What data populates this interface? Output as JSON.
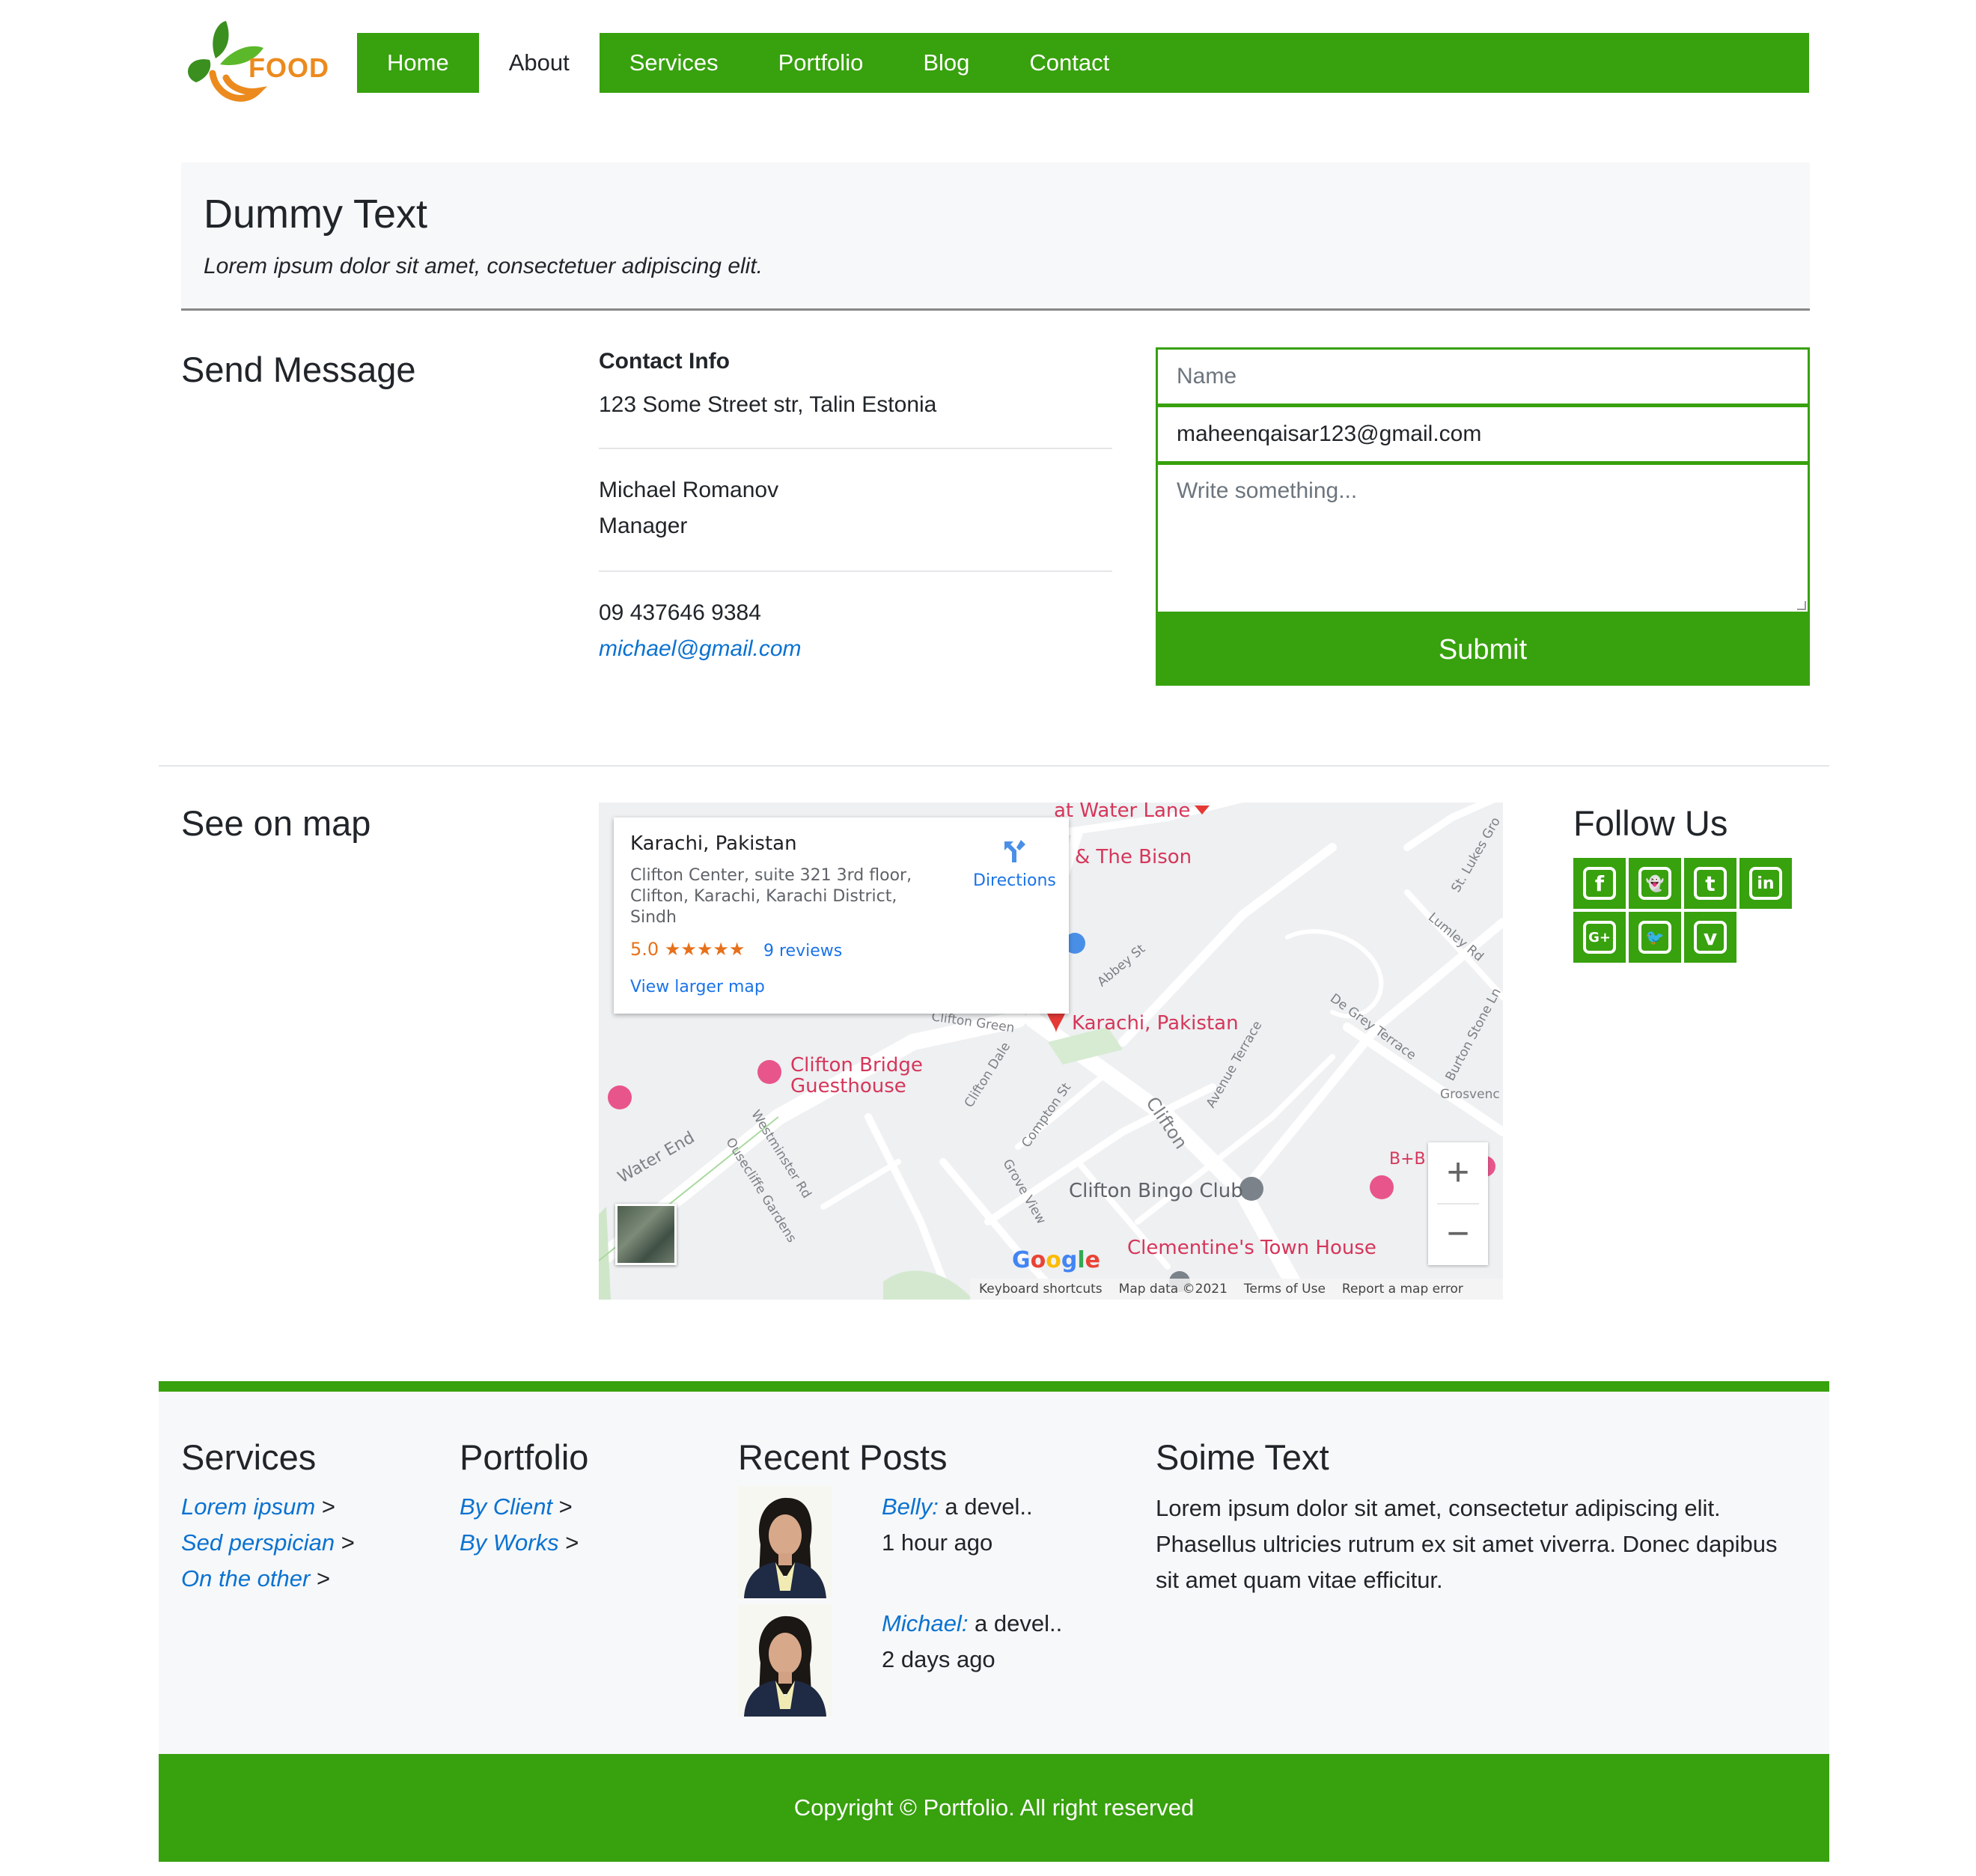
{
  "brand": {
    "logo_text": "FOOD"
  },
  "nav": {
    "items": [
      {
        "label": "Home",
        "active": false
      },
      {
        "label": "About",
        "active": true
      },
      {
        "label": "Services",
        "active": false
      },
      {
        "label": "Portfolio",
        "active": false
      },
      {
        "label": "Blog",
        "active": false
      },
      {
        "label": "Contact",
        "active": false
      }
    ]
  },
  "jumbotron": {
    "title": "Dummy Text",
    "subtitle": "Lorem ipsum dolor sit amet, consectetuer adipiscing elit."
  },
  "send_message": {
    "title": "Send Message",
    "contact_info": {
      "heading": "Contact Info",
      "address": "123 Some Street str, Talin Estonia",
      "person_name": "Michael Romanov",
      "person_role": "Manager",
      "phone": "09 437646 9384",
      "email": "michael@gmail.com"
    },
    "form": {
      "name_placeholder": "Name",
      "email_value": "maheenqaisar123@gmail.com",
      "message_placeholder": "Write something...",
      "submit_label": "Submit"
    }
  },
  "map_section": {
    "title": "See on map",
    "card": {
      "place": "Karachi, Pakistan",
      "address": "Clifton Center, suite 321 3rd floor, Clifton, Karachi, Karachi District, Sindh",
      "rating": "5.0",
      "stars": "★★★★★",
      "reviews": "9 reviews",
      "directions": "Directions",
      "larger_map": "View larger map"
    },
    "labels": {
      "water_lane": "at Water Lane",
      "bison": "& The Bison",
      "pin_label": "Karachi, Pakistan",
      "guesthouse_1": "Clifton Bridge",
      "guesthouse_2": "Guesthouse",
      "bingo": "Clifton Bingo Club",
      "town_house": "Clementine's Town House",
      "bb": "B+B",
      "st_lukes": "St. Lukes Gro",
      "lumley": "Lumley Rd",
      "abbey": "Abbey St",
      "clifton_green": "Clifton Green",
      "de_grey": "De Grey Terrace",
      "burton": "Burton Stone Ln",
      "grosvenor": "Grosvenc",
      "clifton_dale": "Clifton Dale",
      "compton": "Compton St",
      "clifton_road": "Clifton",
      "avenue_terrace": "Avenue Terrace",
      "water_end": "Water End",
      "westminster": "Westminster Rd",
      "ousecliffe": "Ousecliffe Gardens",
      "grove_view": "Grove View"
    },
    "google": "Google",
    "footer_links": [
      "Keyboard shortcuts",
      "Map data ©2021",
      "Terms of Use",
      "Report a map error"
    ],
    "zoom_in": "+",
    "zoom_out": "−"
  },
  "follow": {
    "title": "Follow Us",
    "icons": [
      "facebook-icon",
      "snapchat-icon",
      "tumblr-icon",
      "linkedin-icon",
      "google-plus-icon",
      "twitter-icon",
      "vimeo-icon"
    ],
    "glyphs": [
      "f",
      "👻",
      "t",
      "in",
      "G+",
      "🐦",
      "v"
    ]
  },
  "footer": {
    "services": {
      "title": "Services",
      "links": [
        "Lorem ipsum",
        "Sed perspician",
        "On the other"
      ]
    },
    "portfolio": {
      "title": "Portfolio",
      "links": [
        "By Client",
        "By Works"
      ]
    },
    "recent_posts": {
      "title": "Recent Posts",
      "posts": [
        {
          "author": "Belly:",
          "excerpt": " a devel..",
          "time": "1 hour ago"
        },
        {
          "author": "Michael:",
          "excerpt": " a devel..",
          "time": "2 days ago"
        }
      ]
    },
    "some_text": {
      "title": "Soime Text",
      "body": "Lorem ipsum dolor sit amet, consectetur adipiscing elit. Phasellus ultricies rutrum ex sit amet viverra. Donec dapibus sit amet quam vitae efficitur."
    },
    "arrow": ">",
    "copyright": "Copyright © Portfolio. All right reserved"
  },
  "colors": {
    "brand_green": "#38a10e",
    "logo_orange": "#ec8a1e",
    "link_blue": "#0a72d1",
    "map_red": "#d6365a"
  }
}
